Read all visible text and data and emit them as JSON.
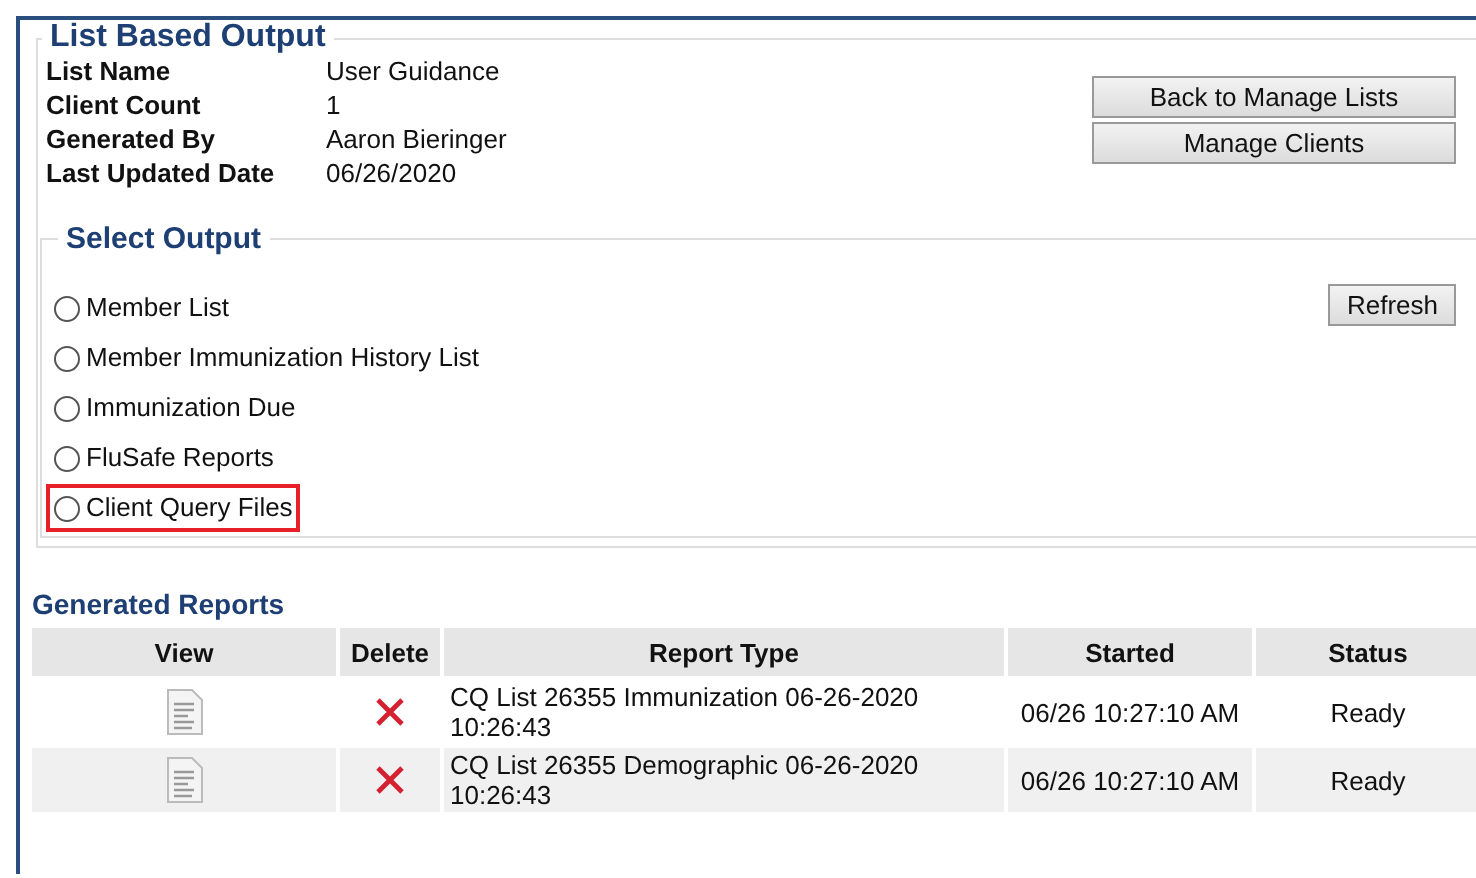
{
  "list_info": {
    "title": "List Based Output",
    "fields": [
      {
        "label": "List Name",
        "value": "User Guidance"
      },
      {
        "label": "Client Count",
        "value": "1"
      },
      {
        "label": "Generated By",
        "value": "Aaron Bieringer"
      },
      {
        "label": "Last Updated Date",
        "value": "06/26/2020"
      }
    ],
    "buttons": [
      "Back to Manage Lists",
      "Manage Clients"
    ]
  },
  "select_output": {
    "title": "Select Output",
    "refresh_button": "Refresh",
    "options": [
      {
        "label": "Member List",
        "selected": false,
        "highlighted": false
      },
      {
        "label": "Member Immunization History List",
        "selected": false,
        "highlighted": false
      },
      {
        "label": "Immunization Due",
        "selected": false,
        "highlighted": false
      },
      {
        "label": "FluSafe Reports",
        "selected": false,
        "highlighted": false
      },
      {
        "label": "Client Query Files",
        "selected": false,
        "highlighted": true
      }
    ]
  },
  "generated_reports": {
    "title": "Generated Reports",
    "columns": [
      "View",
      "Delete",
      "Report Type",
      "Started",
      "Status"
    ],
    "rows": [
      {
        "report_type": "CQ List 26355 Immunization 06-26-2020 10:26:43",
        "started": "06/26 10:27:10 AM",
        "status": "Ready"
      },
      {
        "report_type": "CQ List 26355 Demographic 06-26-2020 10:26:43",
        "started": "06/26 10:27:10 AM",
        "status": "Ready"
      }
    ]
  }
}
